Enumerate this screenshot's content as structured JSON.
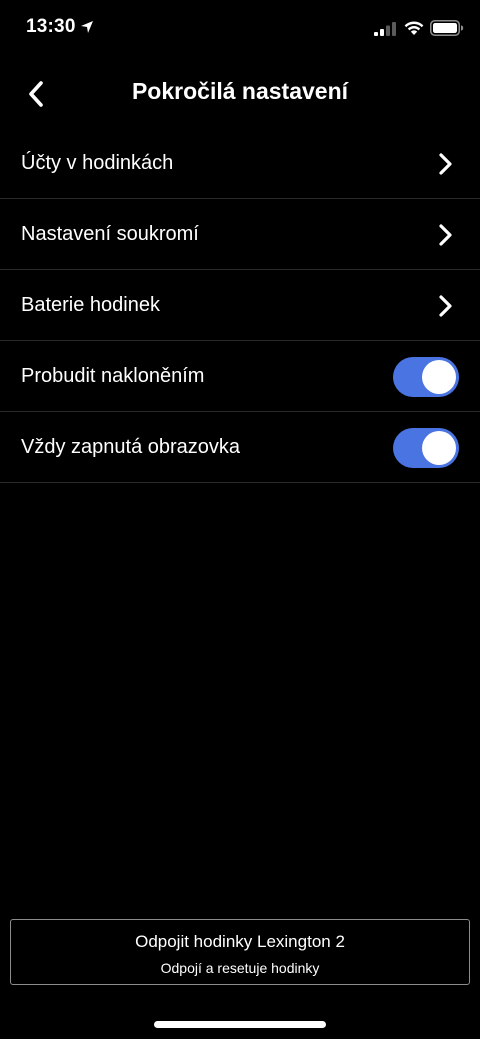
{
  "status_bar": {
    "time": "13:30",
    "icons": [
      "location-arrow-icon",
      "signal-icon",
      "wifi-icon",
      "battery-icon"
    ]
  },
  "header": {
    "back_icon": "chevron-left-icon",
    "title": "Pokročilá nastavení"
  },
  "settings": {
    "items": [
      {
        "label": "Účty v hodinkách",
        "control": "chevron-right-icon"
      },
      {
        "label": "Nastavení soukromí",
        "control": "chevron-right-icon"
      },
      {
        "label": "Baterie hodinek",
        "control": "chevron-right-icon"
      },
      {
        "label": "Probudit nakloněním",
        "control": "toggle",
        "enabled": true
      },
      {
        "label": "Vždy zapnutá obrazovka",
        "control": "toggle",
        "enabled": true
      }
    ]
  },
  "disconnect": {
    "title": "Odpojit hodinky Lexington 2",
    "subtitle": "Odpojí a resetuje hodinky"
  },
  "colors": {
    "background": "#000000",
    "toggle_on": "#4a74e2",
    "divider": "#2a2a2a",
    "button_border": "#8c8c8c"
  }
}
